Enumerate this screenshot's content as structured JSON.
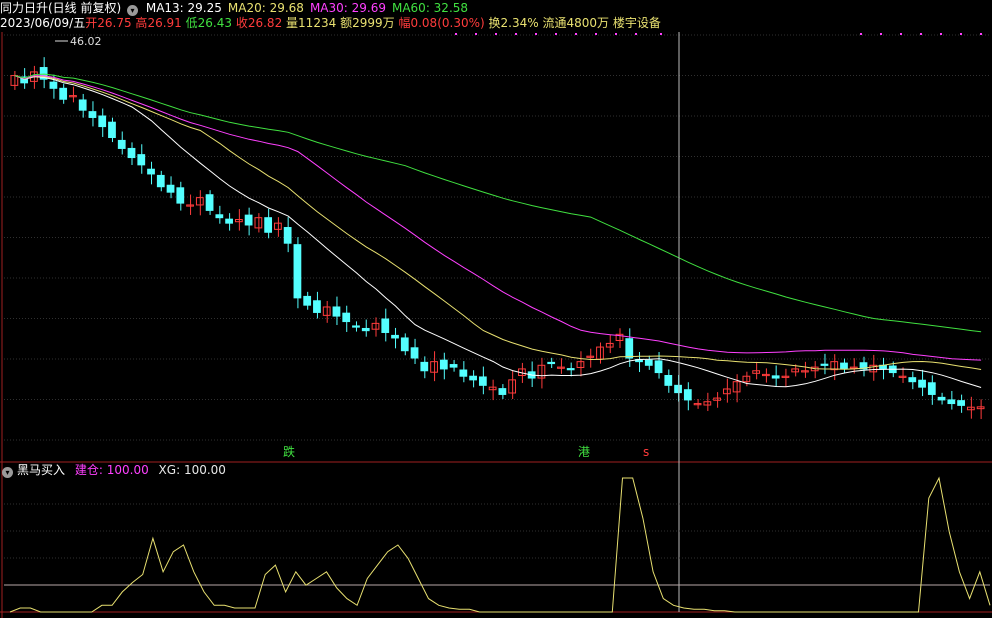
{
  "header": {
    "stock_title": "同力日升(日线 前复权)",
    "ma": [
      {
        "label": "MA13:",
        "value": "29.25",
        "color": "#ffffff"
      },
      {
        "label": "MA20:",
        "value": "29.68",
        "color": "#e8e070"
      },
      {
        "label": "MA30:",
        "value": "29.69",
        "color": "#ff40ff"
      },
      {
        "label": "MA60:",
        "value": "32.58",
        "color": "#40e040"
      }
    ]
  },
  "ohlc": {
    "date": "2023/06/09/五",
    "open_label": "开",
    "open": "26.75",
    "high_label": "高",
    "high": "26.91",
    "low_label": "低",
    "low": "26.43",
    "close_label": "收",
    "close": "26.82",
    "vol_label": "量",
    "vol": "11234",
    "amt_label": "额",
    "amt": "2999万",
    "chg_label": "幅",
    "chg": "0.08(0.30%)",
    "turn_label": "换",
    "turn": "2.34%",
    "float_label": "流通",
    "float": "4800万",
    "sector": "楼宇设备"
  },
  "markers": {
    "high_price": "46.02",
    "m1": "跌",
    "m2": "港",
    "m3": "s"
  },
  "indicator": {
    "name": "黑马买入",
    "line1_label": "建仓:",
    "line1_value": "100.00",
    "line2_label": "XG:",
    "line2_value": "100.00"
  },
  "colors": {
    "up": "#ff3c3c",
    "down": "#54ffff",
    "ma13": "#ffffff",
    "ma20": "#e8e070",
    "ma30": "#ff40ff",
    "ma60": "#40e040",
    "indicator": "#e8e070",
    "axis": "#a02020"
  },
  "chart_data": [
    {
      "type": "candlestick",
      "title": "同力日升(日线 前复权)",
      "price_range": [
        25,
        47.5
      ],
      "note": "approximate price track read from candle positions, oldest to newest",
      "closes": [
        45.0,
        44.6,
        45.2,
        44.8,
        44.3,
        43.7,
        43.9,
        43.1,
        42.7,
        42.2,
        41.6,
        41.0,
        40.5,
        40.1,
        39.6,
        38.9,
        38.6,
        38.0,
        37.9,
        38.3,
        37.6,
        37.2,
        36.9,
        37.1,
        36.8,
        37.2,
        36.4,
        36.9,
        35.8,
        32.8,
        32.4,
        32.0,
        32.3,
        31.8,
        31.5,
        31.2,
        31.0,
        31.4,
        30.9,
        30.6,
        29.9,
        29.5,
        28.8,
        29.3,
        28.9,
        29.0,
        28.5,
        28.3,
        28.0,
        27.9,
        27.5,
        28.3,
        28.9,
        28.4,
        29.1,
        29.2,
        29.0,
        28.9,
        29.3,
        29.6,
        30.1,
        30.3,
        30.8,
        29.5,
        29.3,
        29.1,
        28.7,
        28.0,
        27.6,
        27.2,
        27.0,
        27.1,
        27.3,
        27.8,
        28.2,
        28.5,
        28.8,
        28.6,
        28.4,
        28.5,
        28.9,
        28.8,
        29.0,
        29.1,
        29.3,
        28.9,
        29.0,
        28.9,
        29.1,
        28.9,
        28.7,
        28.5,
        28.2,
        27.9,
        27.5,
        27.2,
        27.0,
        26.9,
        26.8,
        26.82
      ],
      "ma_values": {
        "MA13": 29.25,
        "MA20": 29.68,
        "MA30": 29.69,
        "MA60": 32.58
      }
    },
    {
      "type": "line",
      "title": "黑马买入",
      "ylim": [
        0,
        100
      ],
      "series": [
        {
          "name": "建仓",
          "values": [
            0,
            3,
            3,
            0,
            0,
            0,
            0,
            0,
            0,
            5,
            5,
            15,
            22,
            28,
            55,
            30,
            45,
            50,
            30,
            15,
            5,
            5,
            3,
            3,
            3,
            28,
            35,
            15,
            30,
            20,
            25,
            30,
            18,
            10,
            5,
            25,
            35,
            45,
            50,
            40,
            25,
            10,
            5,
            3,
            2,
            2,
            0,
            0,
            0,
            0,
            0,
            0,
            0,
            0,
            0,
            0,
            0,
            0,
            0,
            0,
            100,
            100,
            70,
            30,
            10,
            5,
            3,
            2,
            2,
            1,
            1,
            0,
            0,
            0,
            0,
            0,
            0,
            0,
            0,
            0,
            0,
            0,
            0,
            0,
            0,
            0,
            0,
            0,
            0,
            0,
            85,
            100,
            60,
            30,
            10,
            30,
            5
          ]
        }
      ]
    }
  ]
}
